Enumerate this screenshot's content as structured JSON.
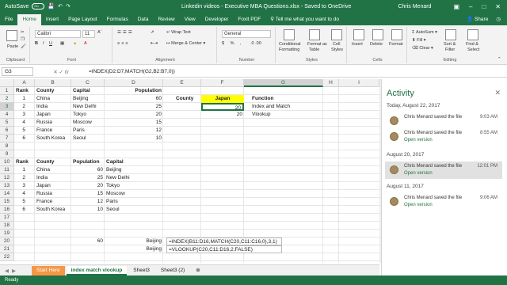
{
  "titlebar": {
    "autosave_label": "AutoSave",
    "autosave_state": "On",
    "title": "Linkedin videos - Executive MBA Questions.xlsx  -  Saved to OneDrive",
    "user": "Chris Menard"
  },
  "tabs": [
    "File",
    "Home",
    "Insert",
    "Page Layout",
    "Formulas",
    "Data",
    "Review",
    "View",
    "Developer",
    "Foxit PDF"
  ],
  "tell_me": "Tell me what you want to do",
  "share": "Share",
  "ribbon": {
    "clipboard": {
      "label": "Clipboard",
      "paste": "Paste"
    },
    "font": {
      "label": "Font",
      "name": "Calibri",
      "size": "11"
    },
    "alignment": {
      "label": "Alignment",
      "wrap": "Wrap Text",
      "merge": "Merge & Center"
    },
    "number": {
      "label": "Number",
      "format": "General"
    },
    "styles": {
      "label": "Styles",
      "cond": "Conditional",
      "cond2": "Formatting",
      "fmt_table": "Format as",
      "fmt_table2": "Table",
      "cell_styles": "Cell",
      "cell_styles2": "Styles"
    },
    "cells": {
      "label": "Cells",
      "insert": "Insert",
      "delete": "Delete",
      "format": "Format"
    },
    "editing": {
      "label": "Editing",
      "autosum": "AutoSum",
      "fill": "Fill",
      "clear": "Clear",
      "sort": "Sort &",
      "sort2": "Filter",
      "find": "Find &",
      "find2": "Select"
    }
  },
  "formula_bar": {
    "name_box": "G3",
    "fx": "fx",
    "formula": "=INDEX(D2:D7,MATCH(G2,B2:B7,0))"
  },
  "columns": [
    "A",
    "B",
    "C",
    "D",
    "E",
    "F",
    "G",
    "H",
    "I",
    "J",
    "K",
    "L",
    "M"
  ],
  "rows": [
    "1",
    "2",
    "3",
    "4",
    "5",
    "6",
    "7",
    "8",
    "9",
    "10",
    "11",
    "12",
    "13",
    "14",
    "15",
    "16",
    "17",
    "18",
    "19",
    "20",
    "21",
    "22"
  ],
  "table1": {
    "headers": [
      "Rank",
      "County",
      "Capital",
      "Population"
    ],
    "rows": [
      [
        "1",
        "China",
        "Beijing",
        "60"
      ],
      [
        "2",
        "India",
        "New Delhi",
        "25"
      ],
      [
        "3",
        "Japan",
        "Tokyo",
        "20"
      ],
      [
        "4",
        "Russia",
        "Moscow",
        "15"
      ],
      [
        "5",
        "France",
        "Paris",
        "12"
      ],
      [
        "6",
        "South Korea",
        "Seoul",
        "10"
      ]
    ]
  },
  "lookup": {
    "county_label": "County",
    "input": "Japan",
    "result1": "20",
    "result2": "20",
    "function_label": "Function",
    "fn1": "Index and Match",
    "fn2": "Vlookup"
  },
  "table2": {
    "headers": [
      "Rank",
      "County",
      "Population",
      "Capital"
    ],
    "rows": [
      [
        "1",
        "China",
        "60",
        "Beijing"
      ],
      [
        "2",
        "India",
        "25",
        "New Delhi"
      ],
      [
        "3",
        "Japan",
        "20",
        "Tokyo"
      ],
      [
        "4",
        "Russia",
        "15",
        "Moscow"
      ],
      [
        "5",
        "France",
        "12",
        "Paris"
      ],
      [
        "6",
        "South Korea",
        "10",
        "Seoul"
      ]
    ]
  },
  "bottom": {
    "c20": "60",
    "d20": "Beijing",
    "d21": "Beijing",
    "f20": "=INDEX(B11:D16,MATCH(C20,C11:C16,0),3,1)",
    "f21": "=VLOOKUP(C20,C11:D16,2,FALSE)"
  },
  "sheets": [
    "Start Here",
    "index match vlookup",
    "Sheet3",
    "Sheet3 (2)"
  ],
  "status": "Ready",
  "activity": {
    "title": "Activity",
    "groups": [
      {
        "date": "Today, August 22, 2017",
        "entries": [
          {
            "name": "Chris Menard saved the file",
            "time": "9:03 AM",
            "open": ""
          },
          {
            "name": "Chris Menard saved the file",
            "time": "8:55 AM",
            "open": "Open version"
          }
        ]
      },
      {
        "date": "August 20, 2017",
        "entries": [
          {
            "name": "Chris Menard saved the file",
            "time": "12:01 PM",
            "open": "Open version"
          }
        ]
      },
      {
        "date": "August 11, 2017",
        "entries": [
          {
            "name": "Chris Menard saved the file",
            "time": "9:06 AM",
            "open": "Open version"
          }
        ]
      }
    ]
  }
}
